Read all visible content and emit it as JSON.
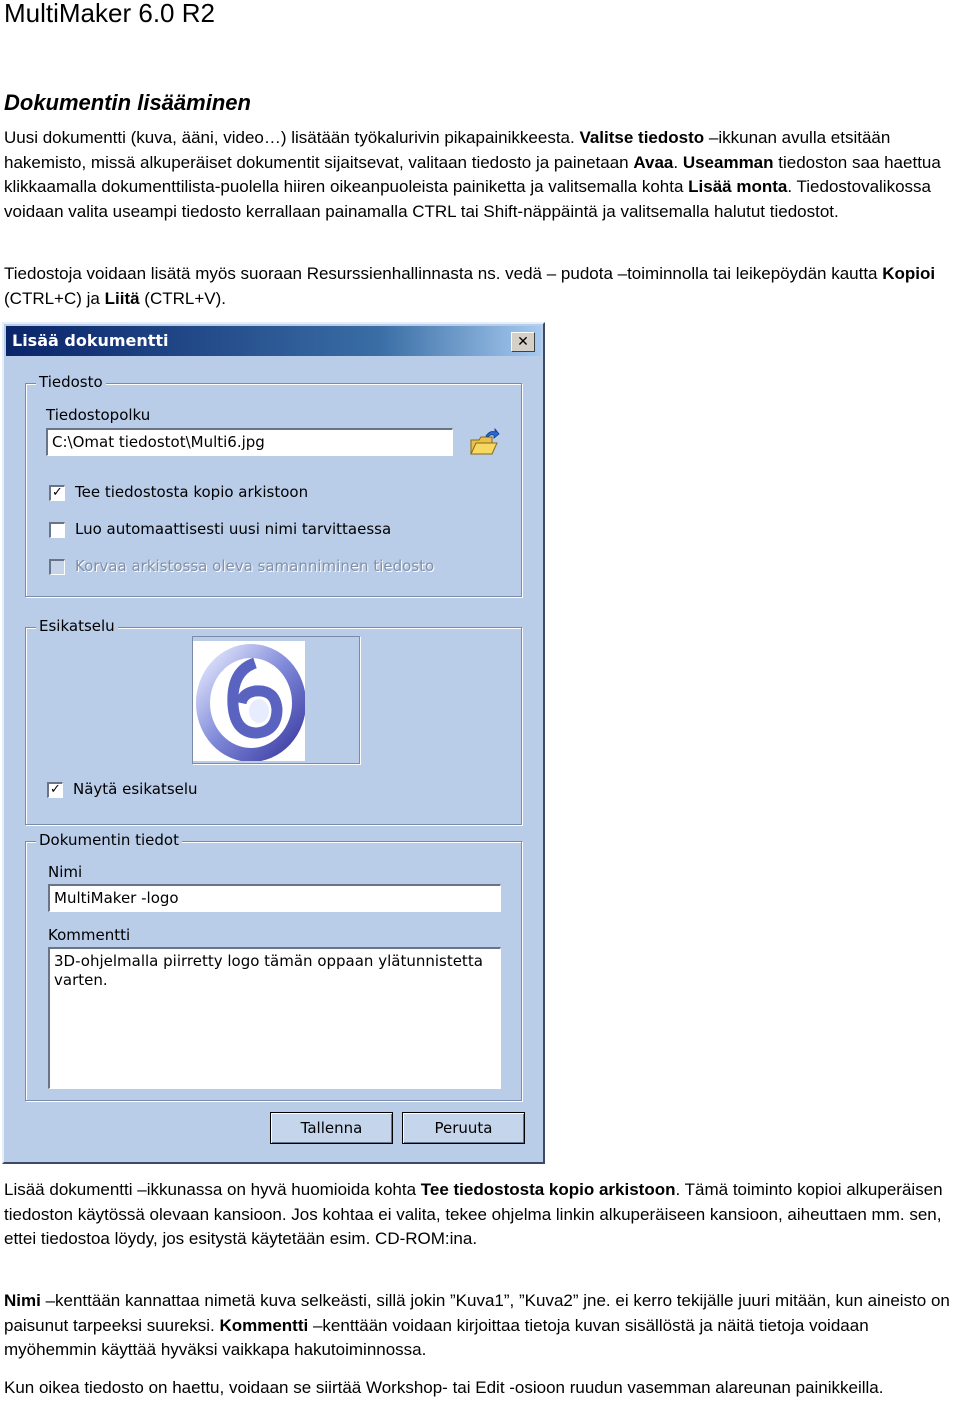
{
  "header": {
    "app_title": "MultiMaker 6.0 R2"
  },
  "section": {
    "title": "Dokumentin lisääminen"
  },
  "intro": {
    "p1_a": "Uusi dokumentti (kuva, ääni, video…) lisätään työkalurivin pikapainikkeesta. ",
    "p1_b": "Valitse tiedosto",
    "p1_c": " –ikkunan avulla etsitään hakemisto, missä alkuperäiset dokumentit sijaitsevat, valitaan tiedosto ja painetaan ",
    "p1_d": "Avaa",
    "p1_e": ". ",
    "p1_f": "Useamman",
    "p1_g": " tiedoston saa haettua klikkaamalla dokumenttilista-puolella hiiren oikeanpuoleista painiketta ja valitsemalla kohta ",
    "p1_h": "Lisää monta",
    "p1_i": ". Tiedostovalikossa voidaan valita useampi tiedosto kerrallaan painamalla CTRL tai Shift-näppäintä ja valitsemalla halutut tiedostot.",
    "p2_a": "Tiedostoja voidaan lisätä myös suoraan Resurssienhallinnasta ns. vedä – pudota –toiminnolla tai leikepöydän kautta ",
    "p2_b": "Kopioi",
    "p2_c": " (CTRL+C) ja ",
    "p2_d": "Liitä",
    "p2_e": " (CTRL+V)."
  },
  "dialog": {
    "title": "Lisää dokumentti",
    "close_label": "✕",
    "files_group": {
      "label": "Tiedosto",
      "path_label": "Tiedostopolku",
      "path_value": "C:\\Omat tiedostot\\Multi6.jpg",
      "copy_checkbox": {
        "label": "Tee tiedostosta kopio arkistoon",
        "checked": true
      },
      "autoname_checkbox": {
        "label": "Luo automaattisesti uusi nimi tarvittaessa",
        "checked": false
      },
      "replace_checkbox": {
        "label": "Korvaa arkistossa oleva samanniminen tiedosto",
        "checked": false
      }
    },
    "preview_group": {
      "label": "Esikatselu",
      "show_checkbox": {
        "label": "Näytä esikatselu",
        "checked": true
      }
    },
    "info_group": {
      "label": "Dokumentin tiedot",
      "name_label": "Nimi",
      "name_value": "MultiMaker -logo",
      "comment_label": "Kommentti",
      "comment_value": "3D-ohjelmalla piirretty logo tämän oppaan ylätunnistetta varten."
    },
    "save_button": "Tallenna",
    "cancel_button": "Peruuta"
  },
  "body": {
    "p3_a": "Lisää dokumentti –ikkunassa on hyvä huomioida kohta ",
    "p3_b": "Tee tiedostosta kopio arkistoon",
    "p3_c": ". Tämä toiminto kopioi alkuperäisen tiedoston käytössä olevaan kansioon. Jos kohtaa ei valita, tekee ohjelma linkin alkuperäiseen kansioon, aiheuttaen mm. sen, ettei tiedostoa löydy, jos esitystä käytetään esim. CD-ROM:ina.",
    "p4_a": "Nimi",
    "p4_b": " –kenttään kannattaa nimetä kuva selkeästi, sillä jokin ”Kuva1”, ”Kuva2” jne. ei kerro tekijälle juuri mitään, kun aineisto on paisunut tarpeeksi suureksi. ",
    "p4_c": "Kommentti",
    "p4_d": " –kenttään voidaan kirjoittaa tietoja kuvan sisällöstä ja näitä tietoja voidaan myöhemmin käyttää hyväksi vaikkapa hakutoiminnossa.",
    "p5": "Kun oikea tiedosto on haettu, voidaan se siirtää Workshop- tai Edit -osioon ruudun vasemman alareunan painikkeilla."
  }
}
